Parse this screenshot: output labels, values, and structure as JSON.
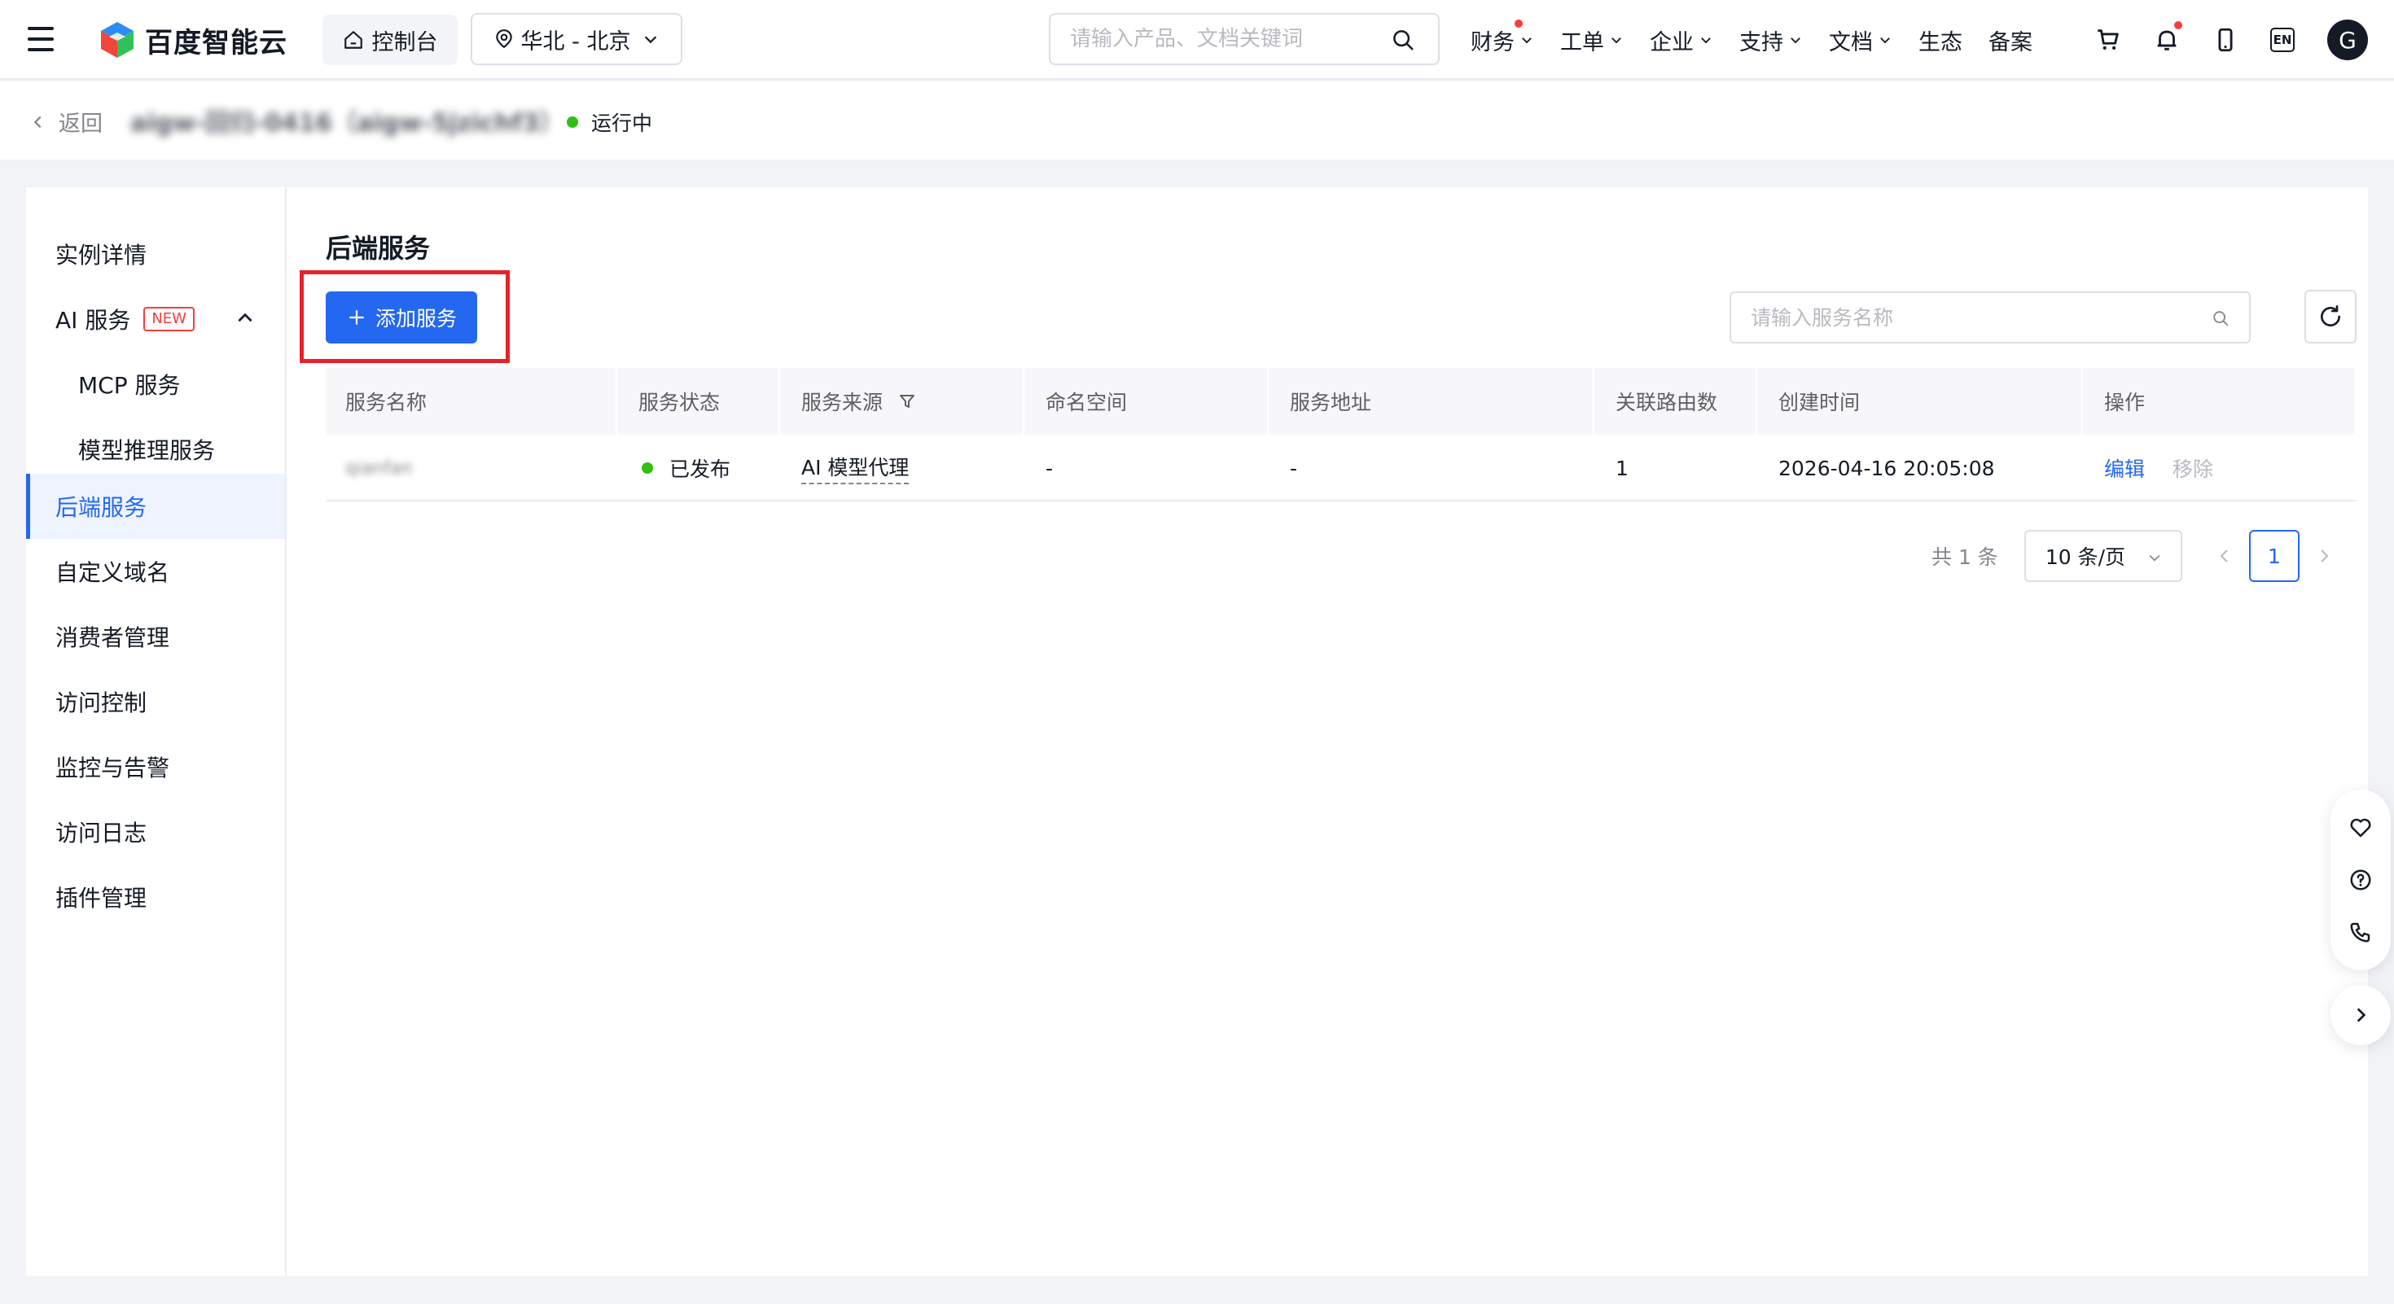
{
  "topnav": {
    "brand": "百度智能云",
    "console": "控制台",
    "region": "华北 - 北京",
    "search_placeholder": "请输入产品、文档关键词",
    "menu": [
      {
        "label": "财务",
        "has_chevron": true,
        "has_dot": true
      },
      {
        "label": "工单",
        "has_chevron": true,
        "has_dot": false
      },
      {
        "label": "企业",
        "has_chevron": true,
        "has_dot": false
      },
      {
        "label": "支持",
        "has_chevron": true,
        "has_dot": false
      },
      {
        "label": "文档",
        "has_chevron": true,
        "has_dot": false
      },
      {
        "label": "生态",
        "has_chevron": false,
        "has_dot": false
      },
      {
        "label": "备案",
        "has_chevron": false,
        "has_dot": false
      }
    ],
    "icons": [
      "cart-icon",
      "bell-icon",
      "mobile-icon",
      "language-icon"
    ],
    "language_label": "EN",
    "avatar_initial": "G"
  },
  "subheader": {
    "back": "返回",
    "instance_name": "aigw-回归-0416（aigw-5jzichf3）",
    "status": "运行中"
  },
  "sidebar": {
    "items": [
      {
        "label": "实例详情",
        "level": 1,
        "active": false
      },
      {
        "label": "AI 服务",
        "level": 1,
        "active": false,
        "badge": "NEW",
        "expanded": true
      },
      {
        "label": "MCP 服务",
        "level": 2,
        "active": false
      },
      {
        "label": "模型推理服务",
        "level": 2,
        "active": false
      },
      {
        "label": "后端服务",
        "level": 1,
        "active": true
      },
      {
        "label": "自定义域名",
        "level": 1,
        "active": false
      },
      {
        "label": "消费者管理",
        "level": 1,
        "active": false
      },
      {
        "label": "访问控制",
        "level": 1,
        "active": false
      },
      {
        "label": "监控与告警",
        "level": 1,
        "active": false
      },
      {
        "label": "访问日志",
        "level": 1,
        "active": false
      },
      {
        "label": "插件管理",
        "level": 1,
        "active": false
      }
    ]
  },
  "main": {
    "title": "后端服务",
    "add_button": "添加服务",
    "search_placeholder": "请输入服务名称",
    "table": {
      "columns": [
        "服务名称",
        "服务状态",
        "服务来源",
        "命名空间",
        "服务地址",
        "关联路由数",
        "创建时间",
        "操作"
      ],
      "rows": [
        {
          "name": "qianfan",
          "status": "已发布",
          "source": "AI 模型代理",
          "namespace": "-",
          "address": "-",
          "routes": "1",
          "created": "2026-04-16 20:05:08",
          "actions": [
            "编辑",
            "移除"
          ]
        }
      ]
    },
    "pagination": {
      "total": "共 1 条",
      "page_size": "10 条/页",
      "current_page": "1"
    }
  },
  "colors": {
    "primary": "#2468f2",
    "success": "#30bf13",
    "danger": "#e8202a",
    "text": "#151b26",
    "muted": "#84868c"
  }
}
